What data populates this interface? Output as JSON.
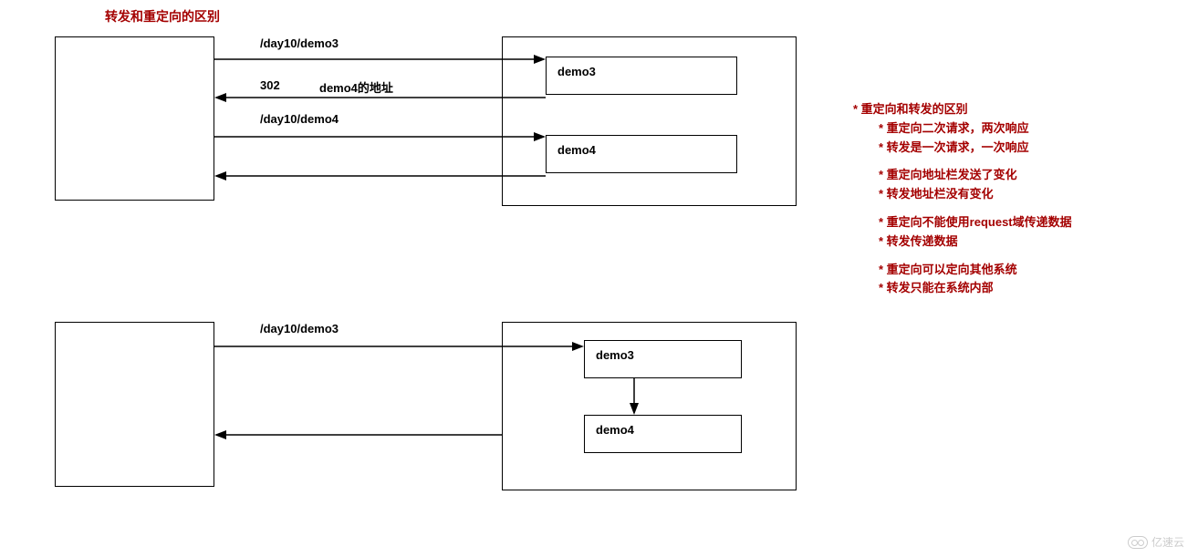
{
  "title": "转发和重定向的区别",
  "diagram1": {
    "arrows": {
      "req1": "/day10/demo3",
      "resp302_code": "302",
      "resp302_addr": "demo4的地址",
      "req2": "/day10/demo4"
    },
    "server": {
      "top_box": "demo3",
      "bottom_box": "demo4"
    }
  },
  "diagram2": {
    "arrows": {
      "req": "/day10/demo3"
    },
    "server": {
      "top_box": "demo3",
      "bottom_box": "demo4"
    }
  },
  "notes": {
    "heading": "* 重定向和转发的区别",
    "group1": [
      "* 重定向二次请求，两次响应",
      "* 转发是一次请求，一次响应"
    ],
    "group2": [
      "* 重定向地址栏发送了变化",
      "* 转发地址栏没有变化"
    ],
    "group3": [
      "* 重定向不能使用request域传递数据",
      "* 转发传递数据"
    ],
    "group4": [
      "* 重定向可以定向其他系统",
      "* 转发只能在系统内部"
    ]
  },
  "watermark": "亿速云"
}
